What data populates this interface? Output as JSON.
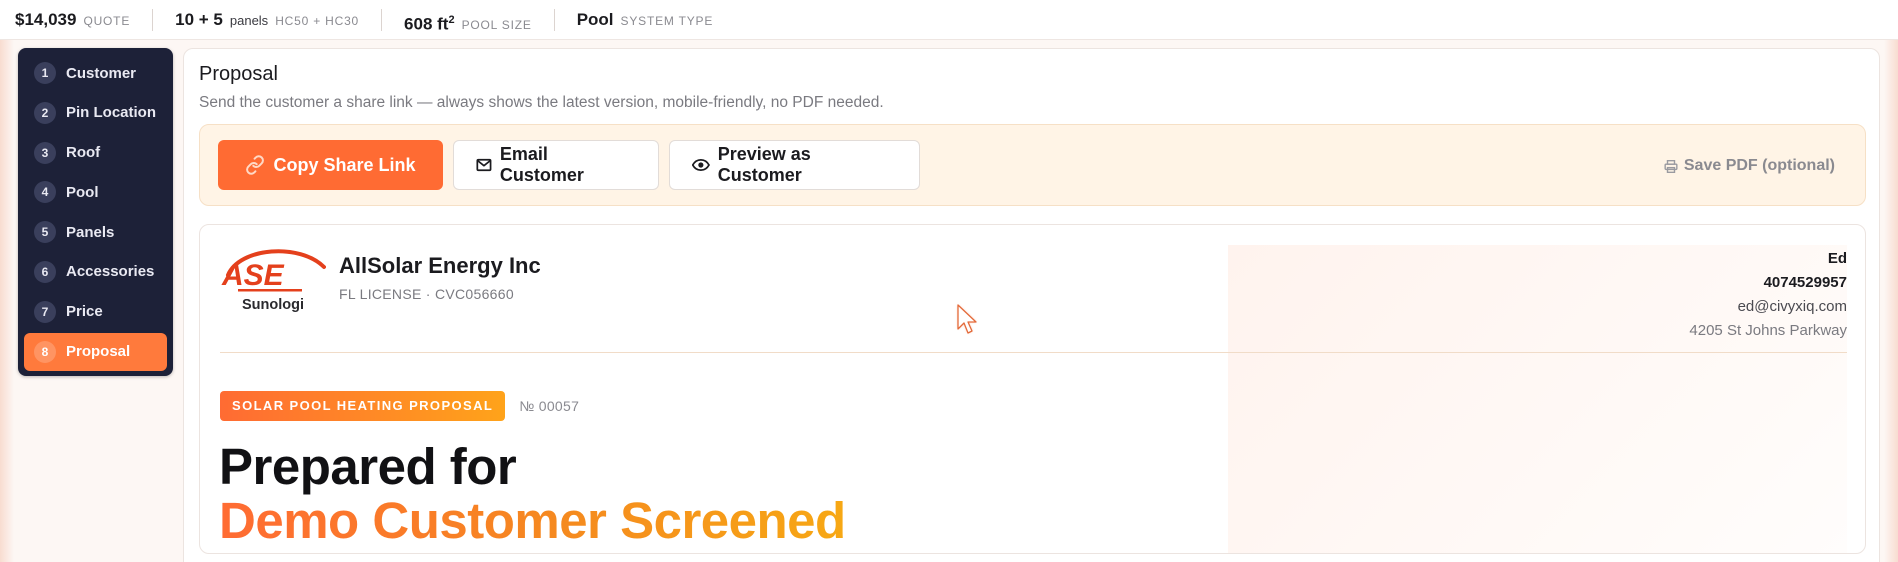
{
  "stats": [
    {
      "value": "$14,039",
      "label": "QUOTE"
    },
    {
      "value": "10 + 5",
      "sub": "panels",
      "label": "HC50 + HC30"
    },
    {
      "value": "608 ft",
      "sup": "2",
      "label": "POOL SIZE"
    },
    {
      "value": "Pool",
      "label": "SYSTEM TYPE"
    }
  ],
  "sidebar": {
    "items": [
      {
        "num": "1",
        "label": "Customer"
      },
      {
        "num": "2",
        "label": "Pin Location"
      },
      {
        "num": "3",
        "label": "Roof"
      },
      {
        "num": "4",
        "label": "Pool"
      },
      {
        "num": "5",
        "label": "Panels"
      },
      {
        "num": "6",
        "label": "Accessories"
      },
      {
        "num": "7",
        "label": "Price"
      },
      {
        "num": "8",
        "label": "Proposal"
      }
    ],
    "active_index": 7
  },
  "main": {
    "title": "Proposal",
    "description": "Send the customer a share link — always shows the latest version, mobile-friendly, no PDF needed."
  },
  "actions": {
    "copy_link": "Copy Share Link",
    "email": "Email Customer",
    "preview": "Preview as Customer",
    "save_pdf": "Save PDF (optional)"
  },
  "proposal": {
    "logo_text": "ASE",
    "logo_sub": "Sunologi",
    "company_name": "AllSolar Energy Inc",
    "license": "FL LICENSE · CVC056660",
    "contact": {
      "name": "Ed",
      "phone": "4074529957",
      "email": "ed@civyxiq.com",
      "address": "4205 St Johns Parkway"
    },
    "badge": "SOLAR POOL HEATING PROPOSAL",
    "number": "№ 00057",
    "headline_line1": "Prepared for",
    "headline_line2": "Demo Customer Screened"
  },
  "colors": {
    "accent": "#ff6b33",
    "sidebar_bg": "#1d2138",
    "actionbar_bg": "#fff4e6"
  }
}
